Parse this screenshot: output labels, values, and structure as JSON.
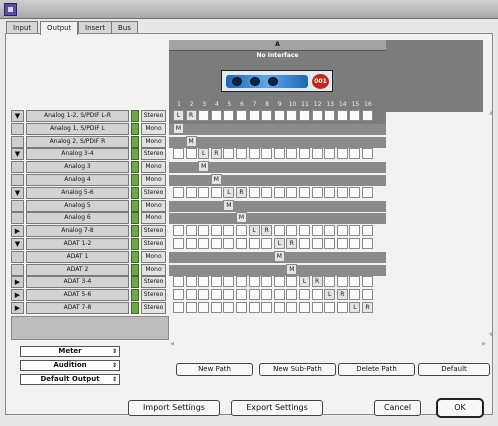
{
  "tabs": [
    {
      "label": "Input"
    },
    {
      "label": "Output"
    },
    {
      "label": "Insert"
    },
    {
      "label": "Bus"
    }
  ],
  "header": {
    "group_label": "A",
    "interface_label": "No Interface",
    "interface_number": "001"
  },
  "column_numbers": [
    "1",
    "2",
    "3",
    "4",
    "5",
    "6",
    "7",
    "8",
    "9",
    "10",
    "11",
    "12",
    "13",
    "14",
    "15",
    "16"
  ],
  "paths": [
    {
      "name": "Analog 1-2, S/PDIF L-R",
      "type": "Stereo",
      "chevron": "▼",
      "sub": false,
      "cells": [
        {
          "col": 0,
          "label": "L"
        },
        {
          "col": 1,
          "label": "R"
        }
      ]
    },
    {
      "name": "Analog 1, S/PDIF L",
      "type": "Mono",
      "chevron": "",
      "sub": true,
      "cells": [
        {
          "col": 0,
          "label": "M"
        }
      ]
    },
    {
      "name": "Analog 2, S/PDIF R",
      "type": "Mono",
      "chevron": "",
      "sub": true,
      "cells": [
        {
          "col": 1,
          "label": "M"
        }
      ]
    },
    {
      "name": "Analog 3-4",
      "type": "Stereo",
      "chevron": "▼",
      "sub": false,
      "cells": [
        {
          "col": 2,
          "label": "L"
        },
        {
          "col": 3,
          "label": "R"
        }
      ]
    },
    {
      "name": "Analog 3",
      "type": "Mono",
      "chevron": "",
      "sub": true,
      "cells": [
        {
          "col": 2,
          "label": "M"
        }
      ]
    },
    {
      "name": "Analog 4",
      "type": "Mono",
      "chevron": "",
      "sub": true,
      "cells": [
        {
          "col": 3,
          "label": "M"
        }
      ]
    },
    {
      "name": "Analog 5-6",
      "type": "Stereo",
      "chevron": "▼",
      "sub": false,
      "cells": [
        {
          "col": 4,
          "label": "L"
        },
        {
          "col": 5,
          "label": "R"
        }
      ]
    },
    {
      "name": "Analog 5",
      "type": "Mono",
      "chevron": "",
      "sub": true,
      "cells": [
        {
          "col": 4,
          "label": "M"
        }
      ]
    },
    {
      "name": "Analog 6",
      "type": "Mono",
      "chevron": "",
      "sub": true,
      "cells": [
        {
          "col": 5,
          "label": "M"
        }
      ]
    },
    {
      "name": "Analog 7-8",
      "type": "Stereo",
      "chevron": "▶",
      "sub": false,
      "cells": [
        {
          "col": 6,
          "label": "L"
        },
        {
          "col": 7,
          "label": "R"
        }
      ]
    },
    {
      "name": "ADAT 1-2",
      "type": "Stereo",
      "chevron": "▼",
      "sub": false,
      "cells": [
        {
          "col": 8,
          "label": "L"
        },
        {
          "col": 9,
          "label": "R"
        }
      ]
    },
    {
      "name": "ADAT 1",
      "type": "Mono",
      "chevron": "",
      "sub": true,
      "cells": [
        {
          "col": 8,
          "label": "M"
        }
      ]
    },
    {
      "name": "ADAT 2",
      "type": "Mono",
      "chevron": "",
      "sub": true,
      "cells": [
        {
          "col": 9,
          "label": "M"
        }
      ]
    },
    {
      "name": "ADAT 3-4",
      "type": "Stereo",
      "chevron": "▶",
      "sub": false,
      "cells": [
        {
          "col": 10,
          "label": "L"
        },
        {
          "col": 11,
          "label": "R"
        }
      ]
    },
    {
      "name": "ADAT 5-6",
      "type": "Stereo",
      "chevron": "▶",
      "sub": false,
      "cells": [
        {
          "col": 12,
          "label": "L"
        },
        {
          "col": 13,
          "label": "R"
        }
      ]
    },
    {
      "name": "ADAT 7-8",
      "type": "Stereo",
      "chevron": "▶",
      "sub": false,
      "cells": [
        {
          "col": 14,
          "label": "L"
        },
        {
          "col": 15,
          "label": "R"
        }
      ]
    }
  ],
  "selects": [
    {
      "label": "Meter"
    },
    {
      "label": "Audition"
    },
    {
      "label": "Default Output"
    }
  ],
  "path_buttons": [
    {
      "label": "New Path"
    },
    {
      "label": "New Sub-Path"
    },
    {
      "label": "Delete Path"
    },
    {
      "label": "Default"
    }
  ],
  "footer_buttons": [
    {
      "label": "Import Settings"
    },
    {
      "label": "Export Settings"
    }
  ],
  "dialog_buttons": {
    "cancel": "Cancel",
    "ok": "OK"
  },
  "colors": {
    "window": "#e8e8e8",
    "panel": "#f2f2f2",
    "header_dark": "#7c7c7c",
    "green_button": "#6fa84a",
    "interface_blue": "#1e67b6"
  }
}
